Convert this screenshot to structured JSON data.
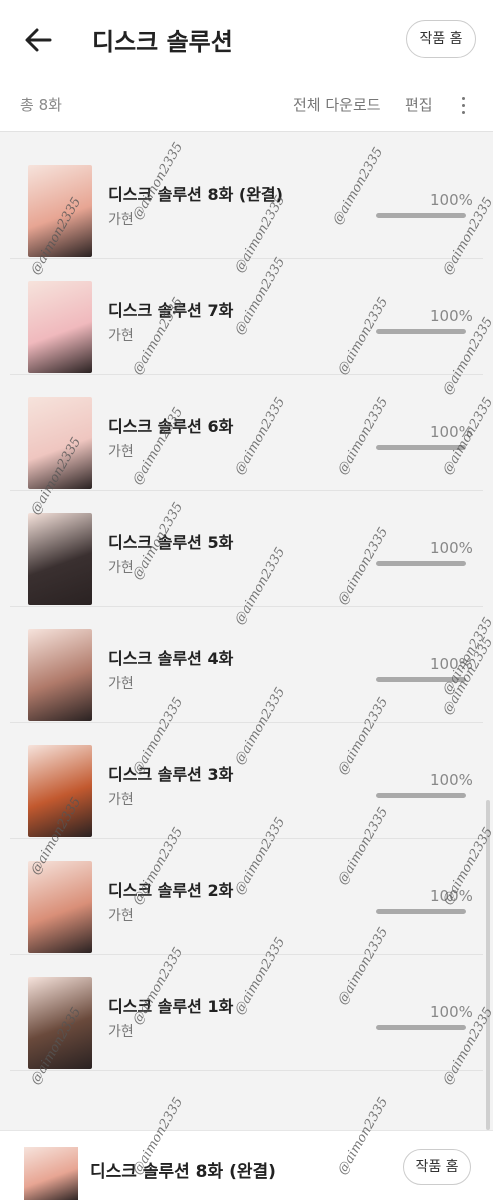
{
  "header": {
    "title": "디스크 솔루션",
    "home_label": "작품 홈",
    "back_icon": "back-arrow-icon"
  },
  "subbar": {
    "count": "총 8화",
    "download_all": "전체 다운로드",
    "edit": "편집",
    "more_icon": "kebab-menu-icon"
  },
  "episodes": [
    {
      "title": "디스크 솔루션 8화 (완결)",
      "author": "가현",
      "progress_label": "100%",
      "progress": 1.0,
      "thumb_color": "#e7a593"
    },
    {
      "title": "디스크 솔루션 7화",
      "author": "가현",
      "progress_label": "100%",
      "progress": 1.0,
      "thumb_color": "#f0b9bd"
    },
    {
      "title": "디스크 솔루션 6화",
      "author": "가현",
      "progress_label": "100%",
      "progress": 1.0,
      "thumb_color": "#efc6c0"
    },
    {
      "title": "디스크 솔루션 5화",
      "author": "가현",
      "progress_label": "100%",
      "progress": 1.0,
      "thumb_color": "#3a3030"
    },
    {
      "title": "디스크 솔루션 4화",
      "author": "가현",
      "progress_label": "100%",
      "progress": 1.0,
      "thumb_color": "#b07a6a"
    },
    {
      "title": "디스크 솔루션 3화",
      "author": "가현",
      "progress_label": "100%",
      "progress": 1.0,
      "thumb_color": "#c2592f"
    },
    {
      "title": "디스크 솔루션 2화",
      "author": "가현",
      "progress_label": "100%",
      "progress": 1.0,
      "thumb_color": "#d98f78"
    },
    {
      "title": "디스크 솔루션 1화",
      "author": "가현",
      "progress_label": "100%",
      "progress": 1.0,
      "thumb_color": "#6a4a3c"
    }
  ],
  "footer": {
    "title": "디스크 솔루션 8화 (완결)",
    "home_label": "작품 홈"
  },
  "watermark": "@aimon2335",
  "colors": {
    "background": "#f3f3f3",
    "progress_fill": "#a9a9a9",
    "progress_track": "#e0e0e0"
  }
}
